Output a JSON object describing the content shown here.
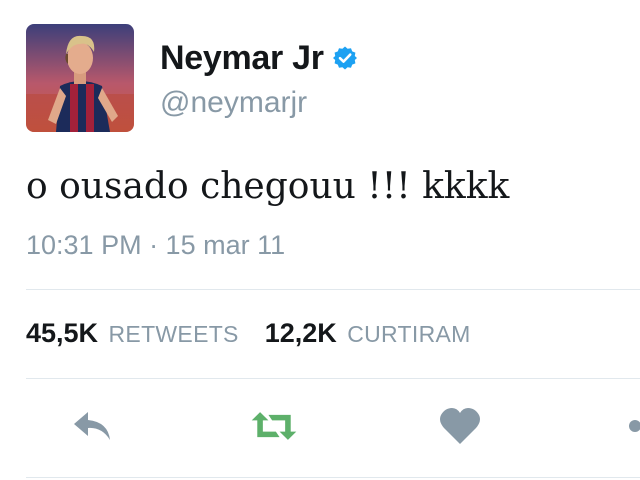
{
  "tweet": {
    "author": {
      "display_name": "Neymar Jr",
      "handle": "@neymarjr",
      "verified_icon": "verified-badge-icon",
      "avatar_icon": "avatar"
    },
    "text": "o ousado chegouu !!! kkkk",
    "timestamp": "10:31 PM · 15 mar 11",
    "stats": {
      "retweets": {
        "count": "45,5K",
        "label": "RETWEETS"
      },
      "likes": {
        "count": "12,2K",
        "label": "CURTIRAM"
      }
    },
    "actions": [
      {
        "icon": "reply-icon"
      },
      {
        "icon": "retweet-icon"
      },
      {
        "icon": "like-heart-icon"
      },
      {
        "icon": "share-icon"
      }
    ]
  },
  "colors": {
    "text_primary": "#14171a",
    "text_secondary": "#8899a6",
    "verified_blue": "#1da1f2",
    "retweet_green": "#5db06a",
    "action_gray": "#8899a6",
    "divider": "#e1e8ed"
  }
}
